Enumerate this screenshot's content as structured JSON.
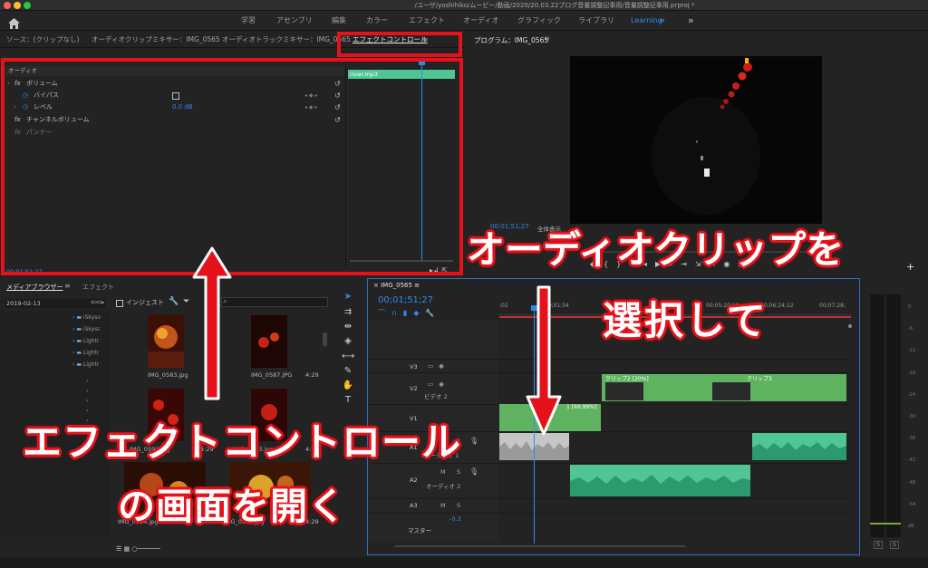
{
  "window": {
    "title": "/ユーザ/yoshihiko/ムービー/動画/2020/20.03.22ブログ音量調整記事用/音量調整記事用.prproj *"
  },
  "workspaces": {
    "items": [
      "学習",
      "アセンブリ",
      "編集",
      "カラー",
      "エフェクト",
      "オーディオ",
      "グラフィック",
      "ライブラリ",
      "Learning"
    ],
    "more": "»"
  },
  "source_panel": {
    "tabs": [
      "ソース：(クリップなし)",
      "オーディオクリップミキサー：IMG_0565",
      "オーディオトラックミキサー：IMG_0565",
      "エフェクトコントロール"
    ],
    "subheader": "オーディオ",
    "rows": [
      "ボリューム",
      "バイパス",
      "レベル",
      "チャンネルボリューム",
      "パンナー"
    ],
    "level_value": "0.0 dB",
    "clip_label": "river.mp3",
    "timecode": "00;01;51;27"
  },
  "program": {
    "title": "プログラム：IMG_0565",
    "timecode": "00;01;51;27",
    "fit": "全体表示"
  },
  "media_browser": {
    "tabs": [
      "メディアブラウザー",
      "エフェクト"
    ],
    "date": "2019-02-13",
    "ingest": "インジェスト",
    "folders": [
      "iSkyso",
      "iSkysc",
      "Lightr",
      "Lightr",
      "Lightr"
    ],
    "search_placeholder": ""
  },
  "thumbs": [
    {
      "name": "IMG_0583.jpg",
      "dur": ""
    },
    {
      "name": "IMG_0587.JPG",
      "dur": "4:29"
    },
    {
      "name": "IMG_0592.jpg",
      "dur": "4:29"
    },
    {
      "name": "IMG_0593.jpg",
      "dur": "4:29"
    },
    {
      "name": "IMG_0594.jpg",
      "dur": "4:29"
    },
    {
      "name": "IMG_0597.jpg",
      "dur": "4:29"
    }
  ],
  "timeline": {
    "tab": "IMG_0565",
    "timecode": "00;01;51;27",
    "ruler": [
      ";02",
      "00;01;04",
      "00;05;20;10",
      "00;06;24;12",
      "00;07;28;"
    ],
    "tracks": {
      "v3": "V3",
      "v2": "V2",
      "v1": "V1",
      "a1": "A1",
      "a2": "A2",
      "a3": "A3",
      "master": "マスター"
    },
    "track_names": {
      "video2": "ビデオ 2",
      "audio1": "オーディオ 1",
      "audio2": "オーディオ 2"
    },
    "master_value": "-0.3",
    "clips": {
      "clip2a": "クリップ2 [20%]",
      "clip2b": "クリップ3",
      "clip1": "1 [69.99%]"
    },
    "mute": "M",
    "solo": "S"
  },
  "annotations": {
    "effect_control": "エフェクトコントロール",
    "open_screen": "の画面を開く",
    "audio_clip": "オーディオクリップを",
    "select": "選択して"
  },
  "meter": {
    "scale": [
      "0",
      "-6",
      "-12",
      "-18",
      "-24",
      "-30",
      "-36",
      "-42",
      "-48",
      "-54",
      "dB"
    ],
    "solo_left": "S",
    "solo_right": "S"
  },
  "colors": {
    "accent": "#2d8ceb",
    "red": "#e6121b",
    "video_clip": "#5fb360",
    "audio_clip": "#4fc694"
  }
}
